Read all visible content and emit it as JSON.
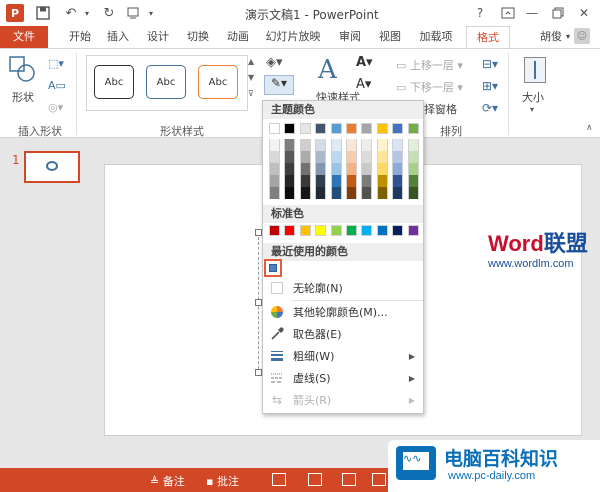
{
  "titlebar": {
    "app_logo": "P",
    "title": "演示文稿1 - PowerPoint",
    "help": "?",
    "icons": [
      "save-icon",
      "undo-icon",
      "redo-icon",
      "customize-icon",
      "minimize-icon",
      "restore-icon",
      "close-icon"
    ]
  },
  "tabs": [
    "文件",
    "开始",
    "插入",
    "设计",
    "切换",
    "动画",
    "幻灯片放映",
    "审阅",
    "视图",
    "加载项",
    "格式"
  ],
  "active_tab": "格式",
  "user": "胡俊",
  "ribbon": {
    "insert_shapes": {
      "shapes_label": "形状",
      "group_label": "插入形状"
    },
    "shape_styles": {
      "abc": [
        "Abc",
        "Abc",
        "Abc"
      ],
      "group_label": "形状样式"
    },
    "wordart": {
      "quick_styles": "快速样式"
    },
    "arrange": {
      "bring_forward": "上移一层",
      "send_backward": "下移一层",
      "selection_pane": "择窗格",
      "group_label": "排列"
    },
    "size": {
      "size_label": "大小"
    }
  },
  "slide_panel": {
    "slide_number": "1"
  },
  "outline_menu": {
    "theme_colors_title": "主题颜色",
    "theme_top_row": [
      "#ffffff",
      "#000000",
      "#e7e6e6",
      "#44546a",
      "#5b9bd5",
      "#ed7d31",
      "#a5a5a5",
      "#ffc000",
      "#4472c4",
      "#70ad47"
    ],
    "theme_shades": [
      [
        "#f2f2f2",
        "#7f7f7f",
        "#d0cece",
        "#d6dce4",
        "#deebf6",
        "#fbe5d5",
        "#ededed",
        "#fff2cc",
        "#dae3f3",
        "#e2efd9"
      ],
      [
        "#d8d8d8",
        "#595959",
        "#aeabab",
        "#adb9ca",
        "#bdd7ee",
        "#f7cbac",
        "#dbdbdb",
        "#fee599",
        "#b4c6e7",
        "#c5e0b3"
      ],
      [
        "#bfbfbf",
        "#3f3f3f",
        "#757070",
        "#8496b0",
        "#9cc3e5",
        "#f4b183",
        "#c9c9c9",
        "#ffd965",
        "#8eaadb",
        "#a8d08d"
      ],
      [
        "#a5a5a5",
        "#262626",
        "#3a3838",
        "#323f4f",
        "#2e75b5",
        "#c55a11",
        "#7b7b7b",
        "#bf9000",
        "#2f5496",
        "#538135"
      ],
      [
        "#7f7f7f",
        "#0c0c0c",
        "#171616",
        "#222a35",
        "#1e4e79",
        "#833c0b",
        "#525252",
        "#7f6000",
        "#1f3864",
        "#375623"
      ]
    ],
    "standard_colors_title": "标准色",
    "standard_colors": [
      "#c00000",
      "#ff0000",
      "#ffc000",
      "#ffff00",
      "#92d050",
      "#00b050",
      "#00b0f0",
      "#0070c0",
      "#002060",
      "#7030a0"
    ],
    "recent_colors_title": "最近使用的颜色",
    "recent_color": "#4f81bd",
    "items": {
      "no_outline": "无轮廓(N)",
      "more_colors": "其他轮廓颜色(M)...",
      "eyedropper": "取色器(E)",
      "weight": "粗细(W)",
      "dashes": "虚线(S)",
      "arrows": "箭头(R)"
    }
  },
  "statusbar": {
    "notes": "备注",
    "comments": "批注"
  },
  "watermarks": {
    "word_a": "Word",
    "word_b": "联盟",
    "word_url": "www.wordlm.com",
    "pc_title": "电脑百科知识",
    "pc_url": "www.pc-daily.com"
  }
}
